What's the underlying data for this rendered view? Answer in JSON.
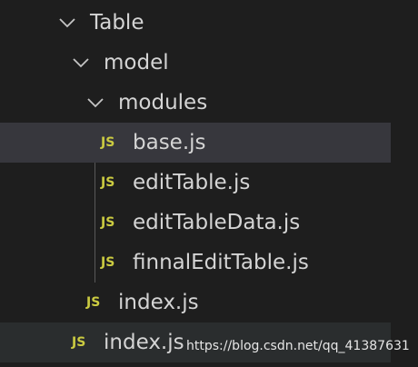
{
  "explorer": {
    "items": [
      {
        "label": "Table",
        "type": "folder",
        "icon": "chevron-down-icon"
      },
      {
        "label": "model",
        "type": "folder",
        "icon": "chevron-down-icon"
      },
      {
        "label": "modules",
        "type": "folder",
        "icon": "chevron-down-icon"
      },
      {
        "label": "base.js",
        "type": "file",
        "icon": "js-icon",
        "icon_text": "JS",
        "selected": true
      },
      {
        "label": "editTable.js",
        "type": "file",
        "icon": "js-icon",
        "icon_text": "JS"
      },
      {
        "label": "editTableData.js",
        "type": "file",
        "icon": "js-icon",
        "icon_text": "JS"
      },
      {
        "label": "finnalEditTable.js",
        "type": "file",
        "icon": "js-icon",
        "icon_text": "JS"
      },
      {
        "label": "index.js",
        "type": "file",
        "icon": "js-icon",
        "icon_text": "JS"
      },
      {
        "label": "index.js",
        "type": "file",
        "icon": "js-icon",
        "icon_text": "JS",
        "hovered": true
      }
    ]
  },
  "watermark": "https://blog.csdn.net/qq_41387631",
  "colors": {
    "background": "#1e1e1e",
    "selected_row": "#37373d",
    "text": "#d4d4d4",
    "js_icon": "#cbcb41",
    "indent_guide": "#585858"
  }
}
